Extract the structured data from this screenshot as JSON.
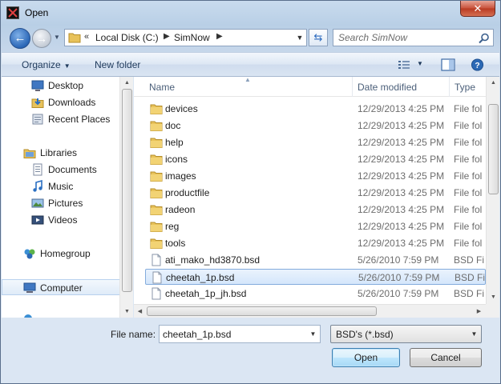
{
  "window": {
    "title": "Open",
    "close_glyph": "✕"
  },
  "address": {
    "overflow": "«",
    "segments": [
      "Local Disk (C:)",
      "SimNow"
    ],
    "search_placeholder": "Search SimNow"
  },
  "toolbar": {
    "organize": "Organize",
    "new_folder": "New folder"
  },
  "nav_pane": {
    "items": [
      {
        "label": "Desktop",
        "icon": "desktop-icon"
      },
      {
        "label": "Downloads",
        "icon": "downloads-folder-icon"
      },
      {
        "label": "Recent Places",
        "icon": "recent-places-icon"
      },
      {
        "label": "Libraries",
        "icon": "libraries-icon"
      },
      {
        "label": "Documents",
        "icon": "documents-icon"
      },
      {
        "label": "Music",
        "icon": "music-icon"
      },
      {
        "label": "Pictures",
        "icon": "pictures-icon"
      },
      {
        "label": "Videos",
        "icon": "videos-icon"
      },
      {
        "label": "Homegroup",
        "icon": "homegroup-icon"
      },
      {
        "label": "Computer",
        "icon": "computer-icon"
      }
    ]
  },
  "columns": {
    "name": "Name",
    "date": "Date modified",
    "type": "Type"
  },
  "files": [
    {
      "name": "devices",
      "date": "12/29/2013 4:25 PM",
      "type": "File fol",
      "kind": "folder"
    },
    {
      "name": "doc",
      "date": "12/29/2013 4:25 PM",
      "type": "File fol",
      "kind": "folder"
    },
    {
      "name": "help",
      "date": "12/29/2013 4:25 PM",
      "type": "File fol",
      "kind": "folder"
    },
    {
      "name": "icons",
      "date": "12/29/2013 4:25 PM",
      "type": "File fol",
      "kind": "folder"
    },
    {
      "name": "images",
      "date": "12/29/2013 4:25 PM",
      "type": "File fol",
      "kind": "folder"
    },
    {
      "name": "productfile",
      "date": "12/29/2013 4:25 PM",
      "type": "File fol",
      "kind": "folder"
    },
    {
      "name": "radeon",
      "date": "12/29/2013 4:25 PM",
      "type": "File fol",
      "kind": "folder"
    },
    {
      "name": "reg",
      "date": "12/29/2013 4:25 PM",
      "type": "File fol",
      "kind": "folder"
    },
    {
      "name": "tools",
      "date": "12/29/2013 4:25 PM",
      "type": "File fol",
      "kind": "folder"
    },
    {
      "name": "ati_mako_hd3870.bsd",
      "date": "5/26/2010 7:59 PM",
      "type": "BSD Fi",
      "kind": "file"
    },
    {
      "name": "cheetah_1p.bsd",
      "date": "5/26/2010 7:59 PM",
      "type": "BSD Fi",
      "kind": "file",
      "selected": true
    },
    {
      "name": "cheetah_1p_jh.bsd",
      "date": "5/26/2010 7:59 PM",
      "type": "BSD Fi",
      "kind": "file"
    }
  ],
  "bottom": {
    "file_name_label": "File name:",
    "file_name_value": "cheetah_1p.bsd",
    "filter_value": "BSD's (*.bsd)",
    "open_label": "Open",
    "cancel_label": "Cancel"
  },
  "colors": {
    "accent": "#3c7fb1",
    "selection": "#d4e6fb",
    "folder": "#e8c25a"
  }
}
